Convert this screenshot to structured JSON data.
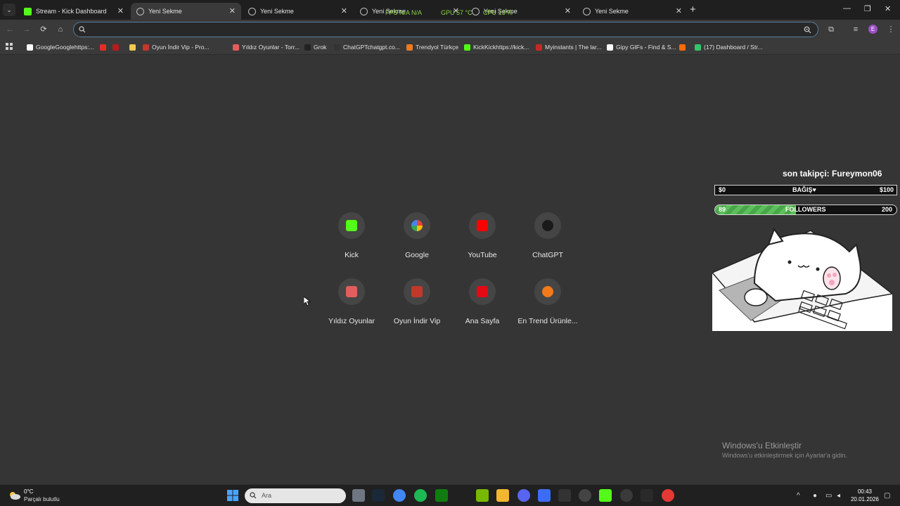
{
  "tabs": [
    {
      "title": "Stream - Kick Dashboard",
      "favicon": "kick-icon"
    },
    {
      "title": "Yeni Sekme",
      "favicon": "globe-icon",
      "active": true
    },
    {
      "title": "Yeni Sekme",
      "favicon": "globe-icon"
    },
    {
      "title": "Yeni Sekme",
      "favicon": "globe-icon"
    },
    {
      "title": "Yeni Sekme",
      "favicon": "globe-icon"
    },
    {
      "title": "Yeni Sekme",
      "favicon": "globe-icon"
    }
  ],
  "hud": {
    "fps": "FPS N/A N/A",
    "gpu": "GPU 57 °C",
    "cpu": "CPU 13 %"
  },
  "omnibox": {
    "value": "",
    "placeholder": ""
  },
  "bookmarks": [
    {
      "label": "GoogleGooglehttps:...",
      "color": "#ffffff"
    },
    {
      "label": "",
      "color": "#e52d27"
    },
    {
      "label": "",
      "color": "#b71c1c"
    },
    {
      "label": "",
      "color": "#f2c94c"
    },
    {
      "label": "Oyun İndir Vip - Pro...",
      "color": "#c0392b"
    },
    {
      "label": "Yıldız Oyunlar - Torr...",
      "color": "#e35d5d"
    },
    {
      "label": "Grok",
      "color": "#222222"
    },
    {
      "label": "ChatGPTchatgpt.co...",
      "color": "#333333"
    },
    {
      "label": "Trendyol Türkçe",
      "color": "#f27a1a"
    },
    {
      "label": "KickKickhttps://kick...",
      "color": "#53fc18"
    },
    {
      "label": "Myinstants | The lar...",
      "color": "#c62828"
    },
    {
      "label": "Gipy GIFs - Find & S...",
      "color": "#ffffff"
    },
    {
      "label": "",
      "color": "#ff6a00"
    },
    {
      "label": "(17) Dashboard / Str...",
      "color": "#35c46b"
    }
  ],
  "shortcuts": [
    {
      "label": "Kick",
      "icon": "kick-icon",
      "color": "#53fc18"
    },
    {
      "label": "Google",
      "icon": "google-icon",
      "color": "#4285f4"
    },
    {
      "label": "YouTube",
      "icon": "youtube-icon",
      "color": "#ff0000"
    },
    {
      "label": "ChatGPT",
      "icon": "chatgpt-icon",
      "color": "#1a1a1a"
    },
    {
      "label": "Yıldız Oyunlar",
      "icon": "yildiz-oyunlar-icon",
      "color": "#e35d5d"
    },
    {
      "label": "Oyun İndir Vip",
      "icon": "gamepad-icon",
      "color": "#c0392b"
    },
    {
      "label": "Ana Sayfa",
      "icon": "netflix-icon",
      "color": "#e50914"
    },
    {
      "label": "En Trend Ürünle...",
      "icon": "trendyol-icon",
      "color": "#f27a1a"
    }
  ],
  "overlay": {
    "last_follower": "son takipçi: Fureymon06",
    "donation": {
      "left": "$0",
      "label": "BAĞIŞ♥",
      "right": "$100"
    },
    "followers": {
      "current": "89",
      "label": "FOLLOWERS",
      "goal": "200",
      "progress": 0.445
    }
  },
  "watermark": {
    "title": "Windows'u Etkinleştir",
    "subtitle": "Windows'u etkinleştirmek için Ayarlar'a gidin."
  },
  "taskbar": {
    "weather_temp": "0°C",
    "weather_desc": "Parçalı bulutlu",
    "search_placeholder": "Ara",
    "time": "00:43",
    "date": "20.01.2026"
  }
}
